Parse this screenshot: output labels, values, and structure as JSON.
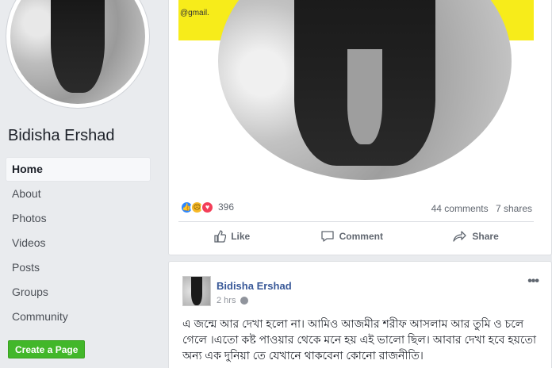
{
  "profile": {
    "name": "Bidisha Ershad"
  },
  "nav": {
    "items": [
      {
        "label": "Home",
        "active": true
      },
      {
        "label": "About"
      },
      {
        "label": "Photos"
      },
      {
        "label": "Videos"
      },
      {
        "label": "Posts"
      },
      {
        "label": "Groups"
      },
      {
        "label": "Community"
      }
    ],
    "create_page": "Create a Page"
  },
  "post1": {
    "photo_text": "@gmail.",
    "reactions_count": "396",
    "comments": "44 comments",
    "shares": "7 shares",
    "actions": {
      "like": "Like",
      "comment": "Comment",
      "share": "Share"
    }
  },
  "post2": {
    "author": "Bidisha Ershad",
    "time": "2 hrs",
    "more": "•••",
    "text": "এ জন্মে আর দেখা হলো না। আমিও আজমীর শরীফ আসলাম আর তুমি ও চলে গেলে ।এতো কষ্ট পাওয়ার থেকে মনে হয় এই ভালো ছিল। আবার দেখা হবে হয়তো অন্য এক দুনিয়া তে যেখানে থাকবেনা কোনো রাজনীতি।"
  },
  "colors": {
    "link": "#385898",
    "create_page": "#42b72a",
    "photo_banner": "#f7ec1a"
  }
}
